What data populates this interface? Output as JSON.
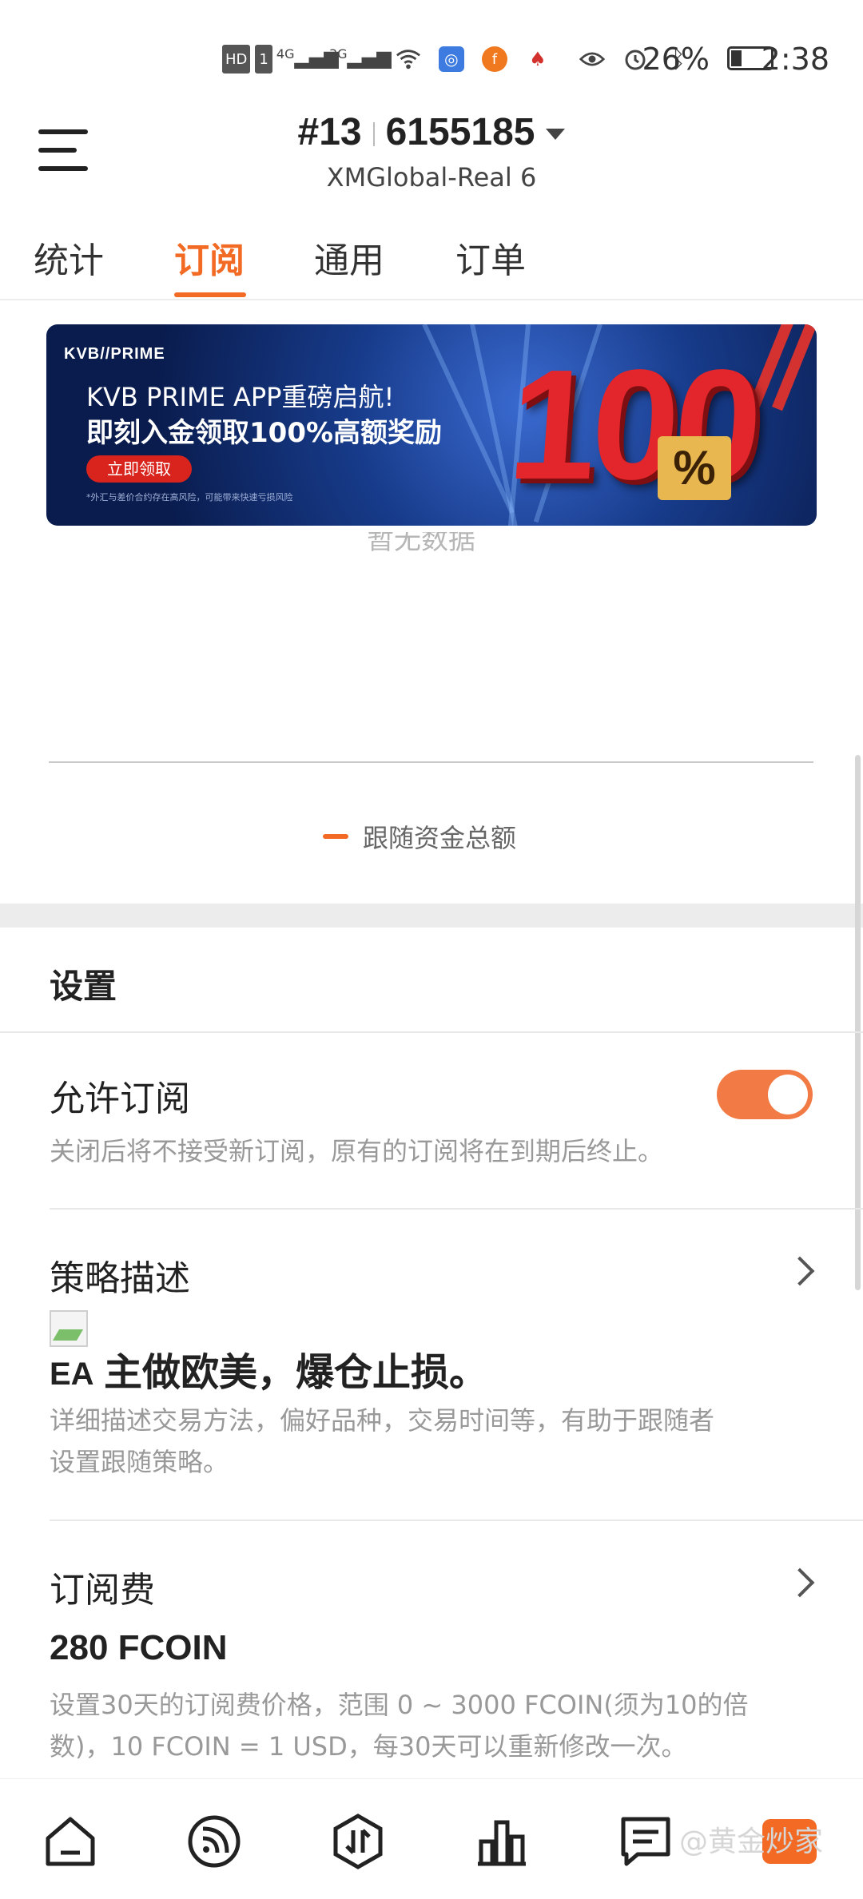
{
  "status_bar": {
    "hd_badge": "HD",
    "sim_badge": "1",
    "net1": "4G",
    "net2": "3G",
    "battery_pct": "26%",
    "battery_level": 0.26,
    "time": "2:38"
  },
  "header": {
    "account_prefix": "#13",
    "account_number": "6155185",
    "server": "XMGlobal-Real 6"
  },
  "tabs": [
    {
      "label": "统计",
      "active": false
    },
    {
      "label": "订阅",
      "active": true
    },
    {
      "label": "通用",
      "active": false
    },
    {
      "label": "订单",
      "active": false
    }
  ],
  "banner": {
    "brand": "KVB//PRIME",
    "line1": "KVB PRIME APP重磅启航!",
    "line2": "即刻入金领取100%高额奖励",
    "cta": "立即领取",
    "disclaimer": "*外汇与差价合约存在高风险，可能带来快速亏损风险",
    "big_number": "100",
    "big_percent": "%"
  },
  "chart": {
    "empty_text": "暂无数据",
    "legend": "跟随资金总额",
    "accent": "#f26a24"
  },
  "settings": {
    "title": "设置",
    "allow_subscribe": {
      "title": "允许订阅",
      "enabled": true,
      "desc": "关闭后将不接受新订阅，原有的订阅将在到期后终止。"
    },
    "strategy": {
      "title": "策略描述",
      "ea_label": "EA",
      "value": "主做欧美，爆仓止损。",
      "desc_line1": "详细描述交易方法，偏好品种，交易时间等，有助于跟随者",
      "desc_line2": "设置跟随策略。"
    },
    "fee": {
      "title": "订阅费",
      "value": "280 FCOIN",
      "desc_line1": "设置30天的订阅费价格，范围 0 ~ 3000 FCOIN(须为10的倍",
      "desc_line2": "数)，10 FCOIN = 1 USD，每30天可以重新修改一次。"
    }
  },
  "bottom_nav": {
    "items": [
      "home-icon",
      "signal-icon",
      "trade-icon",
      "chart-icon",
      "message-icon"
    ],
    "watermark": "@黄金炒家"
  }
}
